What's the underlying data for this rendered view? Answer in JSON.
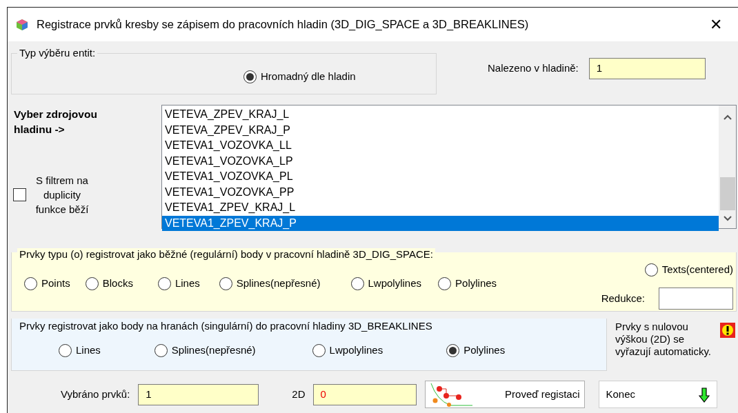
{
  "window": {
    "title": "Registrace prvků kresby se zápisem do pracovních hladin (3D_DIG_SPACE a 3D_BREAKLINES)",
    "close": "✕"
  },
  "selection_type": {
    "legend": "Typ  výběru entit:",
    "options": [
      {
        "label": "Hromadný dle hladin",
        "selected": true
      }
    ]
  },
  "found": {
    "label": "Nalezeno v hladině:",
    "value": "1"
  },
  "source_layer": {
    "label": "Vyber zdrojovou hladinu ->",
    "items": [
      {
        "label": "VETEVA_ZPEV_KRAJ_L",
        "selected": false
      },
      {
        "label": "VETEVA_ZPEV_KRAJ_P",
        "selected": false
      },
      {
        "label": "VETEVA1_VOZOVKA_LL",
        "selected": false
      },
      {
        "label": "VETEVA1_VOZOVKA_LP",
        "selected": false
      },
      {
        "label": "VETEVA1_VOZOVKA_PL",
        "selected": false
      },
      {
        "label": "VETEVA1_VOZOVKA_PP",
        "selected": false
      },
      {
        "label": "VETEVA1_ZPEV_KRAJ_L",
        "selected": false
      },
      {
        "label": "VETEVA1_ZPEV_KRAJ_P",
        "selected": true
      }
    ]
  },
  "filter": {
    "label": "S filtrem na duplicity funkce běží",
    "checked": false
  },
  "regular": {
    "legend": "Prvky typu (o) registrovat jako běžné (regulární) body v pracovní hladině 3D_DIG_SPACE:",
    "options": [
      {
        "label": "Points",
        "selected": false
      },
      {
        "label": "Blocks",
        "selected": false
      },
      {
        "label": "Lines",
        "selected": false
      },
      {
        "label": "Splines(nepřesné)",
        "selected": false
      },
      {
        "label": "Lwpolylines",
        "selected": false
      },
      {
        "label": "Polylines",
        "selected": false
      }
    ],
    "texts_option": {
      "label": "Texts(centered)",
      "selected": false
    },
    "reduction": {
      "label": "Redukce:"
    }
  },
  "breaklines": {
    "legend": "Prvky registrovat jako body na hranách (singulární) do pracovní hladiny 3D_BREAKLINES",
    "options": [
      {
        "label": "Lines",
        "selected": false
      },
      {
        "label": "Splines(nepřesné)",
        "selected": false
      },
      {
        "label": "Lwpolylines",
        "selected": false
      },
      {
        "label": "Polylines",
        "selected": true
      }
    ]
  },
  "note": "Prvky s nulovou výškou (2D) se vyřazují automaticky.",
  "selected_count": {
    "label": "Vybráno prvků:",
    "value": "1"
  },
  "count_2d": {
    "label": "2D",
    "value": "0"
  },
  "buttons": [
    {
      "label": "Proveď registaci",
      "kind": "register"
    },
    {
      "label": "Konec",
      "kind": "close"
    }
  ]
}
